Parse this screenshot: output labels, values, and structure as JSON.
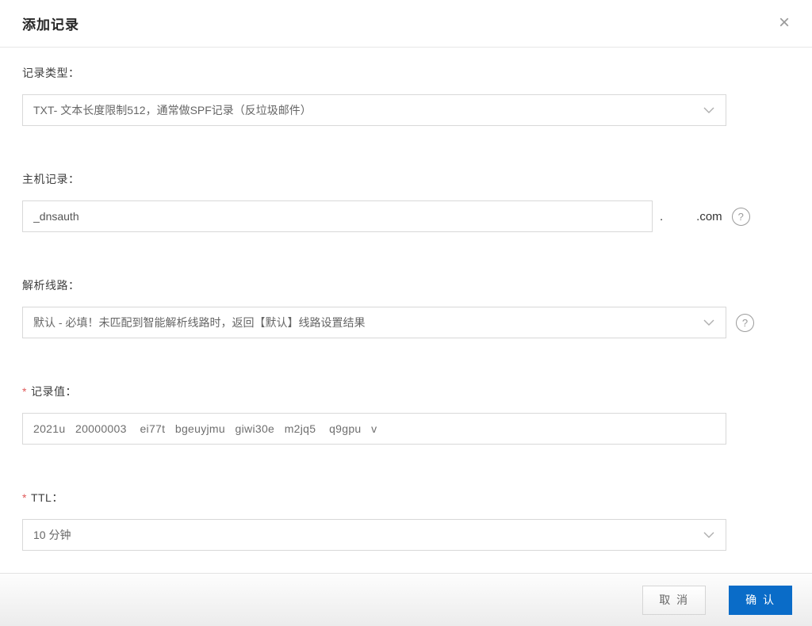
{
  "dialog": {
    "title": "添加记录"
  },
  "icons": {
    "close_glyph": "×",
    "help_glyph": "?"
  },
  "fields": {
    "record_type": {
      "label": "记录类型：",
      "value": "TXT- 文本长度限制512，通常做SPF记录（反垃圾邮件）"
    },
    "host": {
      "label": "主机记录：",
      "value": "_dnsauth",
      "suffix_dot": ".",
      "suffix_tld": ".com"
    },
    "line": {
      "label": "解析线路：",
      "value": "默认 - 必填！未匹配到智能解析线路时，返回【默认】线路设置结果"
    },
    "record_value": {
      "required_mark": "*",
      "label": "记录值：",
      "value": "2021u   20000003    ei77t   bgeuyjmu   giwi30e   m2jq5    q9gpu   v"
    },
    "ttl": {
      "required_mark": "*",
      "label": "TTL：",
      "value": "10 分钟"
    }
  },
  "footer": {
    "cancel_label": "取 消",
    "confirm_label": "确 认"
  },
  "colors": {
    "confirm_blue": "#0a6cc8",
    "required_red": "#e05a5a",
    "border_gray": "#d8d8d8"
  }
}
